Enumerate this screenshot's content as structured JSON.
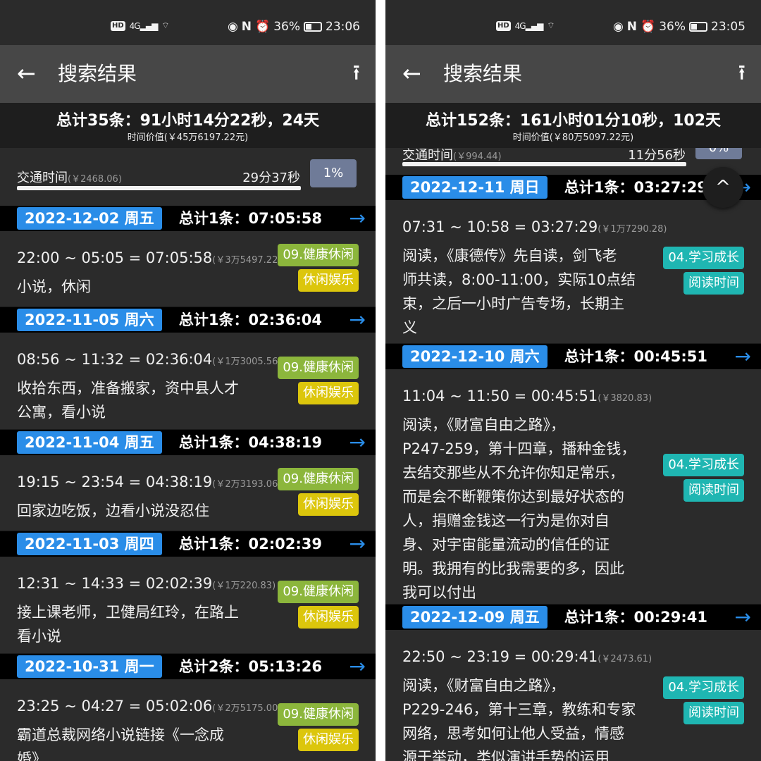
{
  "left": {
    "status": {
      "network": "4G",
      "battery": "36%",
      "time": "23:06"
    },
    "header": {
      "title": "搜索结果"
    },
    "summary": {
      "main": "总计35条：91小时14分22秒，24天",
      "value": "时间价值(￥45万6197.22元)"
    },
    "stat": {
      "label": "交通时间",
      "value": "(￥2468.06)",
      "duration": "29分37秒",
      "percent": "1%"
    },
    "days": [
      {
        "date": "2022-12-02 周五",
        "total": "总计1条：07:05:58",
        "entries": [
          {
            "range": "22:00 ~ 05:05 = 07:05:58",
            "money": "(￥3万5497.22)",
            "desc": [
              "小说，休闲"
            ],
            "tags": [
              "09.健康休闲",
              "休闲娱乐"
            ]
          }
        ]
      },
      {
        "date": "2022-11-05 周六",
        "total": "总计1条：02:36:04",
        "entries": [
          {
            "range": "08:56 ~ 11:32 = 02:36:04",
            "money": "(￥1万3005.56)",
            "desc": [
              "收拾东西，准备搬家，资中县人才",
              "公寓，看小说"
            ],
            "tags": [
              "09.健康休闲",
              "休闲娱乐"
            ]
          }
        ]
      },
      {
        "date": "2022-11-04 周五",
        "total": "总计1条：04:38:19",
        "entries": [
          {
            "range": "19:15 ~ 23:54 = 04:38:19",
            "money": "(￥2万3193.06)",
            "desc": [
              "回家边吃饭，边看小说没忍住"
            ],
            "tags": [
              "09.健康休闲",
              "休闲娱乐"
            ]
          }
        ]
      },
      {
        "date": "2022-11-03 周四",
        "total": "总计1条：02:02:39",
        "entries": [
          {
            "range": "12:31 ~ 14:33 = 02:02:39",
            "money": "(￥1万220.83)",
            "desc": [
              "接上课老师，卫健局红玲，在路上",
              "看小说"
            ],
            "tags": [
              "09.健康休闲",
              "休闲娱乐"
            ]
          }
        ]
      },
      {
        "date": "2022-10-31 周一",
        "total": "总计2条：05:13:26",
        "entries": [
          {
            "range": "23:25 ~ 04:27 = 05:02:06",
            "money": "(￥2万5175.00)",
            "desc": [
              "霸道总裁网络小说链接《一念成",
              "婚》"
            ],
            "tags": [
              "09.健康休闲",
              "休闲娱乐"
            ]
          }
        ]
      }
    ]
  },
  "right": {
    "status": {
      "network": "4G",
      "battery": "36%",
      "time": "23:05"
    },
    "header": {
      "title": "搜索结果"
    },
    "summary": {
      "main": "总计152条：161小时01分10秒，102天",
      "value": "时间价值(￥80万5097.22元)"
    },
    "stat": {
      "label": "交通时间",
      "value": "(￥994.44)",
      "duration": "11分56秒",
      "percent": "0%"
    },
    "days": [
      {
        "date": "2022-12-11 周日",
        "total": "总计1条：03:27:29",
        "entries": [
          {
            "range": "07:31 ~ 10:58 = 03:27:29",
            "money": "(￥1万7290.28)",
            "desc": [
              "阅读，《康德传》先自读，剑飞老",
              "师共读，8:00-11:00，实际10点结",
              "束，之后一小时广告专场，长期主",
              "义"
            ],
            "tags": [
              "04.学习成长",
              "阅读时间"
            ]
          }
        ]
      },
      {
        "date": "2022-12-10 周六",
        "total": "总计1条：00:45:51",
        "entries": [
          {
            "range": "11:04 ~ 11:50 = 00:45:51",
            "money": "(￥3820.83)",
            "desc": [
              "阅读，《财富自由之路》，",
              "P247-259，第十四章，播种金钱，",
              "去结交那些从不允许你知足常乐，",
              "而是会不断鞭策你达到最好状态的",
              "人，捐赠金钱这一行为是你对自",
              "身、对宇宙能量流动的信任的证",
              "明。我拥有的比我需要的多，因此",
              "我可以付出"
            ],
            "tags": [
              "04.学习成长",
              "阅读时间"
            ]
          }
        ]
      },
      {
        "date": "2022-12-09 周五",
        "total": "总计1条：00:29:41",
        "entries": [
          {
            "range": "22:50 ~ 23:19 = 00:29:41",
            "money": "(￥2473.61)",
            "desc": [
              "阅读，《财富自由之路》，",
              "P229-246，第十三章，教练和专家",
              "网络，思考如何让他人受益，情感",
              "源于举动，类似演讲手势的运用"
            ],
            "tags": [
              "04.学习成长",
              "阅读时间"
            ]
          }
        ]
      }
    ]
  },
  "icons": {
    "back": "←",
    "share": "⭱",
    "arrow": "→",
    "up": "^"
  },
  "colors": {
    "date_badge": "#2a8de8",
    "tag_health": "#8cb63c",
    "tag_leisure": "#dcc60c",
    "tag_study": "#1fb6b2",
    "percent_badge": "#6f7b98"
  }
}
